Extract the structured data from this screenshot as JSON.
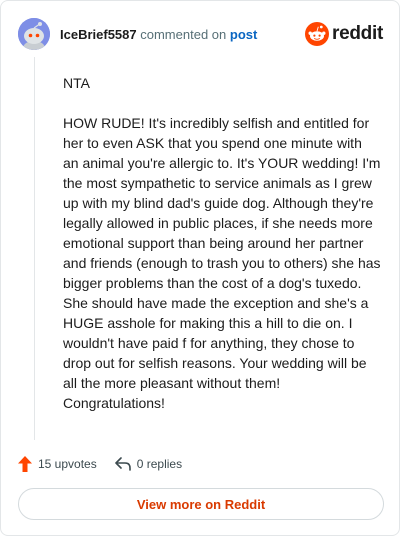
{
  "comment": {
    "username": "IceBrief5587",
    "action_text": "commented on",
    "post_link": "post",
    "brand": "reddit",
    "paragraphs": [
      "NTA",
      "HOW RUDE! It's incredibly selfish and entitled for her to even ASK that you spend one minute with an animal you're allergic to. It's YOUR wedding! I'm the most sympathetic to service animals as I grew up with my blind dad's guide dog. Although they're legally allowed in public places, if she needs more emotional support than being around her partner and friends (enough to trash you to others) she has bigger problems than the cost of a dog's tuxedo. She should have made the exception and she's a HUGE asshole for making this a hill to die on. I wouldn't have paid f for anything, they chose to drop out for selfish reasons. Your wedding will be all the more pleasant without them! Congratulations!"
    ],
    "upvotes_label": "15 upvotes",
    "replies_label": "0 replies",
    "view_more_label": "View more on Reddit"
  },
  "icons": {
    "avatar": "snoo-avatar-icon",
    "logo": "reddit-logo-icon",
    "upvote": "upvote-arrow-icon",
    "reply": "reply-arrow-icon"
  },
  "colors": {
    "brand_orange": "#ff4500",
    "link_blue": "#0a66c2",
    "view_more_text": "#d93a00",
    "avatar_bg": "#7e8ee6"
  }
}
